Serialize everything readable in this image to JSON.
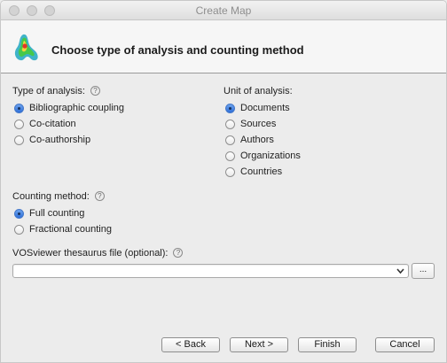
{
  "window": {
    "title": "Create Map"
  },
  "header": {
    "title": "Choose type of analysis and counting method",
    "logo_icon": "vosviewer-logo-icon"
  },
  "type_of_analysis": {
    "label": "Type of analysis:",
    "options": [
      {
        "label": "Bibliographic coupling",
        "selected": true
      },
      {
        "label": "Co-citation",
        "selected": false
      },
      {
        "label": "Co-authorship",
        "selected": false
      }
    ]
  },
  "unit_of_analysis": {
    "label": "Unit of analysis:",
    "options": [
      {
        "label": "Documents",
        "selected": true
      },
      {
        "label": "Sources",
        "selected": false
      },
      {
        "label": "Authors",
        "selected": false
      },
      {
        "label": "Organizations",
        "selected": false
      },
      {
        "label": "Countries",
        "selected": false
      }
    ]
  },
  "counting_method": {
    "label": "Counting method:",
    "options": [
      {
        "label": "Full counting",
        "selected": true
      },
      {
        "label": "Fractional counting",
        "selected": false
      }
    ]
  },
  "thesaurus": {
    "label": "VOSviewer thesaurus file (optional):",
    "value": "",
    "browse_label": "..."
  },
  "help_symbol": "?",
  "buttons": {
    "back": "< Back",
    "next": "Next >",
    "finish": "Finish",
    "cancel": "Cancel"
  },
  "colors": {
    "accent": "#2d6ed8",
    "window_bg": "#ececec"
  }
}
